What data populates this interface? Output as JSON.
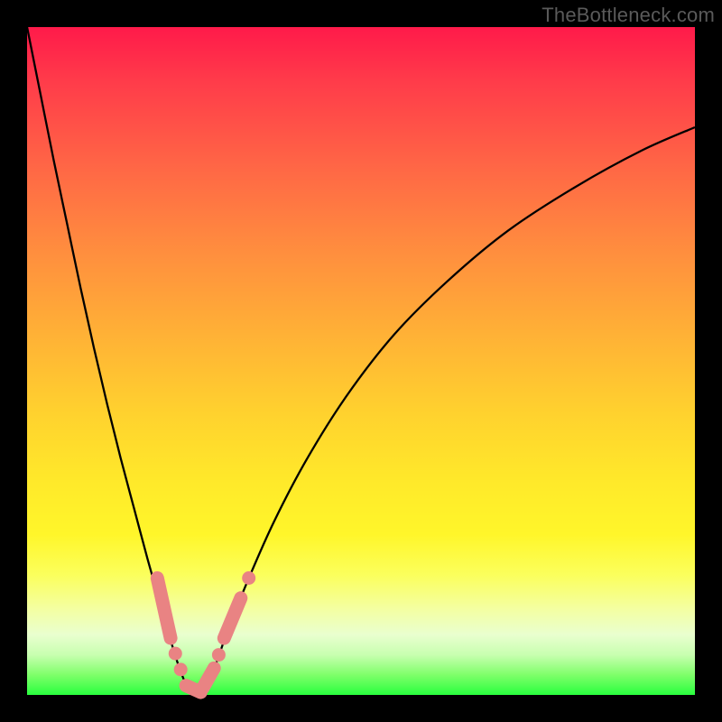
{
  "watermark": "TheBottleneck.com",
  "colors": {
    "frame": "#000000",
    "curve_stroke": "#000000",
    "marker_fill": "#e98383",
    "gradient_stops": [
      "#ff1a4a",
      "#ff6a45",
      "#ffb136",
      "#ffe92a",
      "#f4ffa0",
      "#29ff3e"
    ]
  },
  "chart_data": {
    "type": "line",
    "title": "",
    "xlabel": "",
    "ylabel": "",
    "xlim": [
      0,
      100
    ],
    "ylim": [
      0,
      100
    ],
    "grid": false,
    "legend": false,
    "annotations": [],
    "series": [
      {
        "name": "bottleneck_curve",
        "x": [
          0,
          2,
          4,
          6,
          8,
          10,
          12,
          14,
          16,
          18,
          20,
          21,
          22,
          23,
          24,
          25,
          26,
          28,
          30,
          33,
          37,
          42,
          48,
          55,
          63,
          72,
          82,
          92,
          100
        ],
        "y": [
          100,
          90,
          80,
          70.5,
          61,
          52,
          43.5,
          35.5,
          28,
          20.5,
          13.5,
          10,
          6.5,
          3.5,
          1.2,
          0,
          0.5,
          4,
          9.5,
          17,
          26,
          35.5,
          45,
          54,
          62,
          69.5,
          76,
          81.5,
          85
        ],
        "_comment": "y is 'badness' (0 at bottom/green, 100 at top/red). Minimum (optimal) at x≈25."
      }
    ],
    "markers": [
      {
        "name": "left_cluster_segment_upper",
        "shape": "segment",
        "x": [
          19.5,
          21.5
        ],
        "y": [
          17.5,
          8.5
        ]
      },
      {
        "name": "left_dot_1",
        "shape": "dot",
        "x": 22.2,
        "y": 6.2
      },
      {
        "name": "left_dot_2",
        "shape": "dot",
        "x": 23.0,
        "y": 3.8
      },
      {
        "name": "left_cluster_bottom",
        "shape": "segment",
        "x": [
          23.8,
          26.0
        ],
        "y": [
          1.4,
          0.4
        ]
      },
      {
        "name": "right_cluster_bottom",
        "shape": "segment",
        "x": [
          26.3,
          28.0
        ],
        "y": [
          1.0,
          4.0
        ]
      },
      {
        "name": "right_dot_1",
        "shape": "dot",
        "x": 28.7,
        "y": 6.0
      },
      {
        "name": "right_cluster_upper",
        "shape": "segment",
        "x": [
          29.5,
          32.0
        ],
        "y": [
          8.5,
          14.5
        ]
      },
      {
        "name": "right_dot_top",
        "shape": "dot",
        "x": 33.2,
        "y": 17.5
      }
    ]
  }
}
